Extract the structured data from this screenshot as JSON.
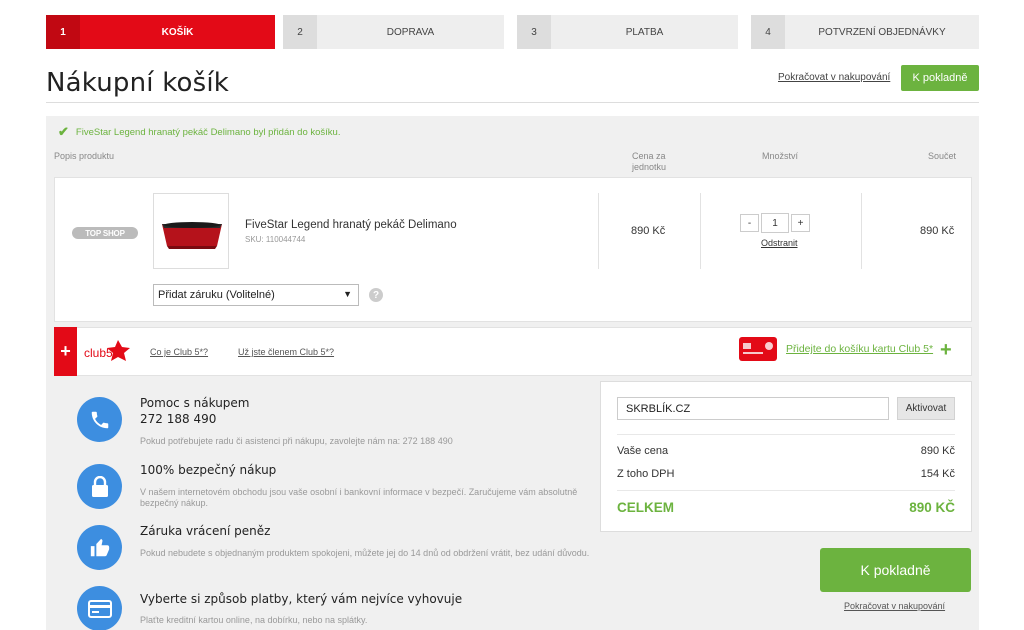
{
  "steps": [
    {
      "num": "1",
      "label": "KOŠÍK"
    },
    {
      "num": "2",
      "label": "DOPRAVA"
    },
    {
      "num": "3",
      "label": "PLATBA"
    },
    {
      "num": "4",
      "label": "POTVRZENÍ OBJEDNÁVKY"
    }
  ],
  "header": {
    "title": "Nákupní košík",
    "continue_label": "Pokračovat v nakupování",
    "checkout_label": "K pokladně"
  },
  "notice": "FiveStar Legend hranatý pekáč Delimano byl přidán do košíku.",
  "columns": {
    "description": "Popis produktu",
    "unit_price": "Cena za jednotku",
    "quantity": "Množství",
    "total": "Součet"
  },
  "product": {
    "shop_badge": "TOP SHOP",
    "name": "FiveStar Legend hranatý pekáč Delimano",
    "sku": "SKU: 110044744",
    "unit_price": "890 Kč",
    "quantity": "1",
    "remove_label": "Odstranit",
    "total": "890 Kč",
    "warranty_select": "Přidat záruku (Volitelné)"
  },
  "club": {
    "logo_text": "club5",
    "link_what": "Co je Club 5*?",
    "link_member": "Už jste členem Club 5*?",
    "add_card_label": "Přidejte do košíku kartu Club 5*"
  },
  "features": [
    {
      "title": "Pomoc s nákupem",
      "subtitle": "272 188 490",
      "desc": "Pokud potřebujete radu či asistenci při nákupu, zavolejte nám na: 272 188 490",
      "icon": "phone-icon"
    },
    {
      "title": "100% bezpečný nákup",
      "desc": "V našem internetovém obchodu jsou vaše osobní i bankovní informace v bezpečí. Zaručujeme vám absolutně bezpečný nákup.",
      "icon": "lock-icon"
    },
    {
      "title": "Záruka vrácení peněz",
      "desc": "Pokud nebudete s objednaným produktem spokojeni, můžete jej do 14 dnů od obdržení vrátit, bez udání důvodu.",
      "icon": "thumbs-up-icon"
    },
    {
      "title": "Vyberte si způsob platby, který vám nejvíce vyhovuje",
      "desc": "Plaťte kreditní kartou online, na dobírku, nebo na splátky.",
      "icon": "credit-card-icon"
    }
  ],
  "summary": {
    "coupon_value": "SKRBLÍK.CZ",
    "activate_label": "Aktivovat",
    "price_label": "Vaše cena",
    "price_value": "890 Kč",
    "vat_label": "Z toho DPH",
    "vat_value": "154 Kč",
    "total_label": "CELKEM",
    "total_value": "890 KČ"
  },
  "footer": {
    "checkout_label": "K pokladně",
    "continue_label": "Pokračovat v nakupování"
  },
  "colors": {
    "accent_red": "#e30a17",
    "accent_green": "#6cb33f",
    "icon_blue": "#3d8ee0"
  }
}
